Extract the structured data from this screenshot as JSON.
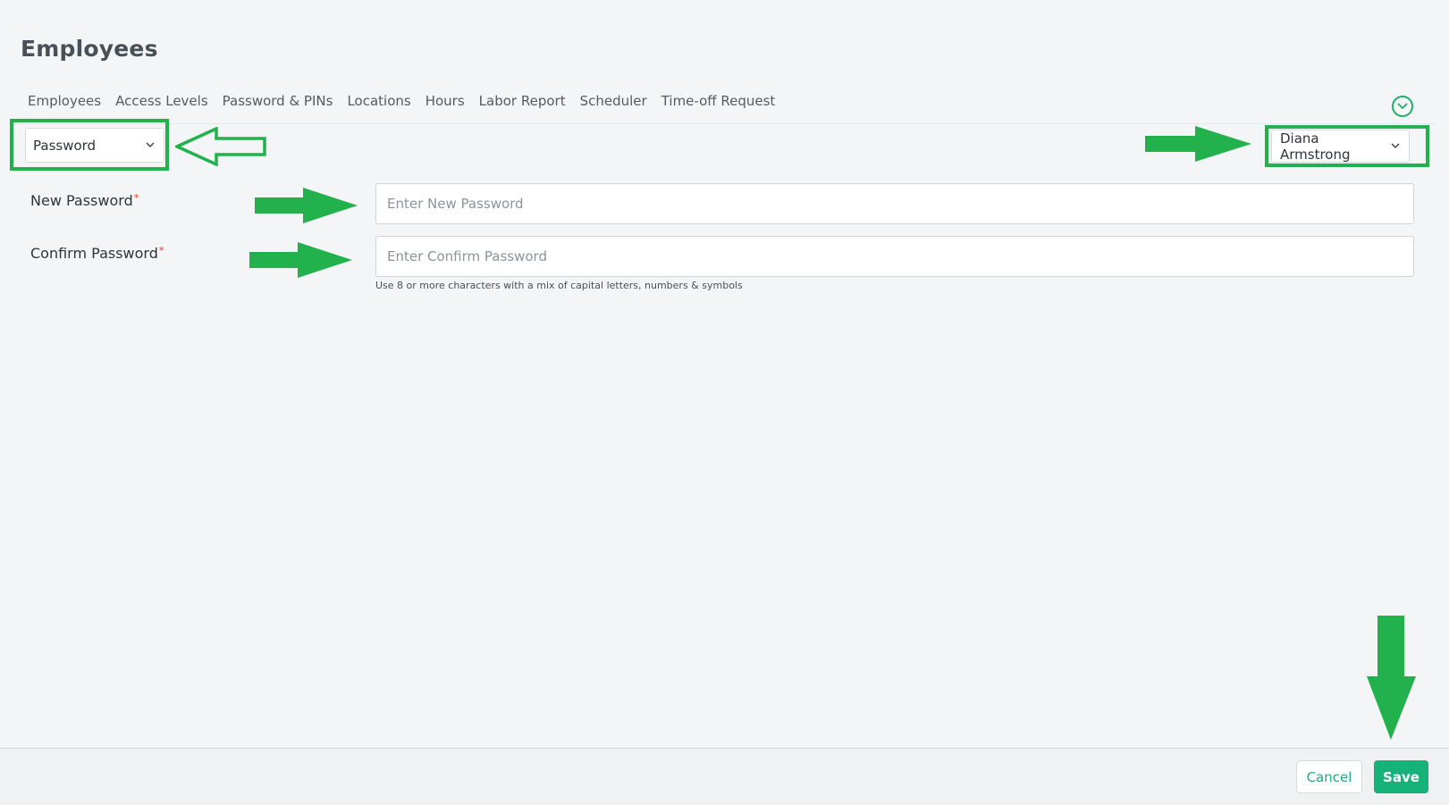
{
  "page": {
    "title": "Employees"
  },
  "tabs": [
    {
      "label": "Employees"
    },
    {
      "label": "Access Levels"
    },
    {
      "label": "Password & PINs"
    },
    {
      "label": "Locations"
    },
    {
      "label": "Hours"
    },
    {
      "label": "Labor Report"
    },
    {
      "label": "Scheduler"
    },
    {
      "label": "Time-off Request"
    }
  ],
  "type_select": {
    "value": "Password"
  },
  "employee_select": {
    "value": "Diana Armstrong"
  },
  "form": {
    "new_password": {
      "label": "New Password",
      "required_mark": "*",
      "placeholder": "Enter New Password",
      "value": ""
    },
    "confirm_password": {
      "label": "Confirm Password",
      "required_mark": "*",
      "placeholder": "Enter Confirm Password",
      "value": ""
    },
    "hint": "Use 8 or more characters with a mix of capital letters, numbers & symbols"
  },
  "footer": {
    "cancel_label": "Cancel",
    "save_label": "Save"
  },
  "colors": {
    "accent": "#15b27a",
    "annotation": "#22b14c",
    "required": "#e0392b"
  },
  "icons": {
    "collapse": "chevron-down-circle-icon",
    "select_chevron": "chevron-down-icon"
  }
}
